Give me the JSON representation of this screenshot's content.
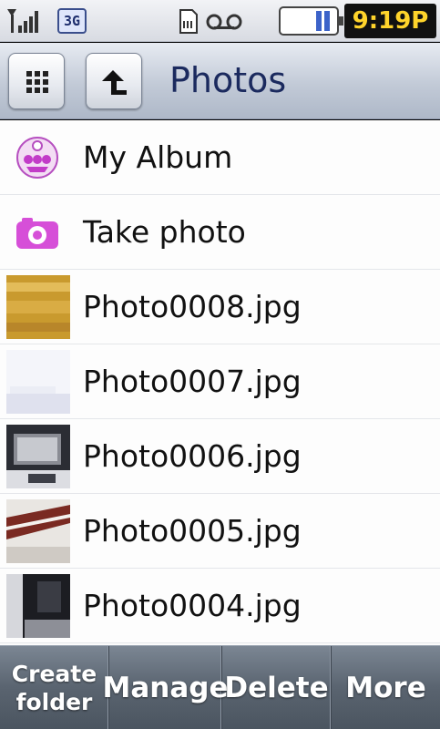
{
  "status_bar": {
    "network_type": "3G",
    "time": "9:19P",
    "icons": [
      "signal-icon",
      "3g-icon",
      "sd-card-icon",
      "voicemail-icon",
      "battery-icon"
    ]
  },
  "header": {
    "title": "Photos",
    "menu_icon": "grid-menu-icon",
    "back_icon": "up-arrow-icon"
  },
  "list": {
    "items": [
      {
        "label": "My Album",
        "kind": "album",
        "icon": "album-icon"
      },
      {
        "label": "Take photo",
        "kind": "camera",
        "icon": "camera-icon"
      },
      {
        "label": "Photo0008.jpg",
        "kind": "photo",
        "icon": "photo-thumbnail"
      },
      {
        "label": "Photo0007.jpg",
        "kind": "photo",
        "icon": "photo-thumbnail"
      },
      {
        "label": "Photo0006.jpg",
        "kind": "photo",
        "icon": "photo-thumbnail"
      },
      {
        "label": "Photo0005.jpg",
        "kind": "photo",
        "icon": "photo-thumbnail"
      },
      {
        "label": "Photo0004.jpg",
        "kind": "photo",
        "icon": "photo-thumbnail"
      }
    ]
  },
  "softkeys": {
    "create_line1": "Create",
    "create_line2": "folder",
    "manage": "Manage",
    "delete": "Delete",
    "more": "More"
  },
  "colors": {
    "title_text": "#1b2a5e",
    "clock_text": "#ffd42b",
    "accent_purple": "#c23cc8",
    "softkey_bg": "#5a6470"
  }
}
